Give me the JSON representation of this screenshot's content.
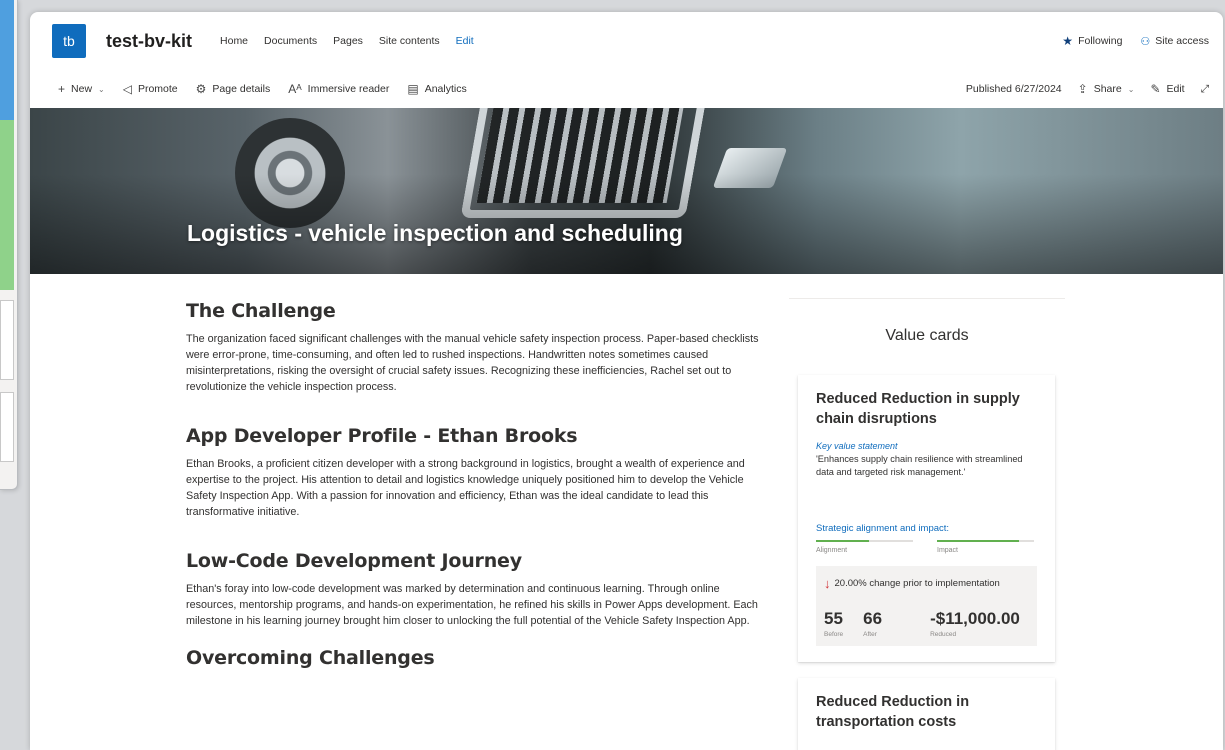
{
  "site": {
    "logo": "tb",
    "title": "test-bv-kit",
    "nav": [
      "Home",
      "Documents",
      "Pages",
      "Site contents",
      "Edit"
    ],
    "following": "Following",
    "site_access": "Site access"
  },
  "command_bar": {
    "new": "New",
    "promote": "Promote",
    "page_details": "Page details",
    "immersive_reader": "Immersive reader",
    "analytics": "Analytics",
    "published": "Published 6/27/2024",
    "share": "Share",
    "edit": "Edit"
  },
  "banner": {
    "title": "Logistics - vehicle inspection and scheduling"
  },
  "article": {
    "sections": [
      {
        "heading": "The Challenge",
        "body": "The organization faced significant challenges with the manual vehicle safety inspection process. Paper-based checklists were error-prone, time-consuming, and often led to rushed inspections. Handwritten notes sometimes caused misinterpretations, risking the oversight of crucial safety issues. Recognizing these inefficiencies, Rachel set out to revolutionize the vehicle inspection process."
      },
      {
        "heading": "App Developer Profile - Ethan Brooks",
        "body": "Ethan Brooks, a proficient citizen developer with a strong background in logistics, brought a wealth of experience and expertise to the project. His attention to detail and logistics knowledge uniquely positioned him to develop the Vehicle Safety Inspection App. With a passion for innovation and efficiency, Ethan was the ideal candidate to lead this transformative initiative."
      },
      {
        "heading": "Low-Code Development Journey",
        "body": "Ethan's foray into low-code development was marked by determination and continuous learning. Through online resources, mentorship programs, and hands-on experimentation, he refined his skills in Power Apps development. Each milestone in his learning journey brought him closer to unlocking the full potential of the Vehicle Safety Inspection App."
      },
      {
        "heading": "Overcoming Challenges",
        "body": ""
      }
    ]
  },
  "value_cards": {
    "heading": "Value cards",
    "cards": [
      {
        "title": "Reduced Reduction in supply chain disruptions",
        "key_value_label": "Key value statement",
        "key_value_text": "'Enhances supply chain resilience with streamlined data and targeted risk management.'",
        "strategic_label": "Strategic alignment and impact:",
        "alignment_label": "Alignment",
        "alignment_level": 0.55,
        "impact_label": "Impact",
        "impact_level": 0.85,
        "change_text": "20.00% change prior to implementation",
        "before_value": "55",
        "before_label": "Before",
        "after_value": "66",
        "after_label": "After",
        "reduced_value": "-$11,000.00",
        "reduced_label": "Reduced"
      },
      {
        "title": "Reduced Reduction in transportation costs"
      }
    ]
  }
}
